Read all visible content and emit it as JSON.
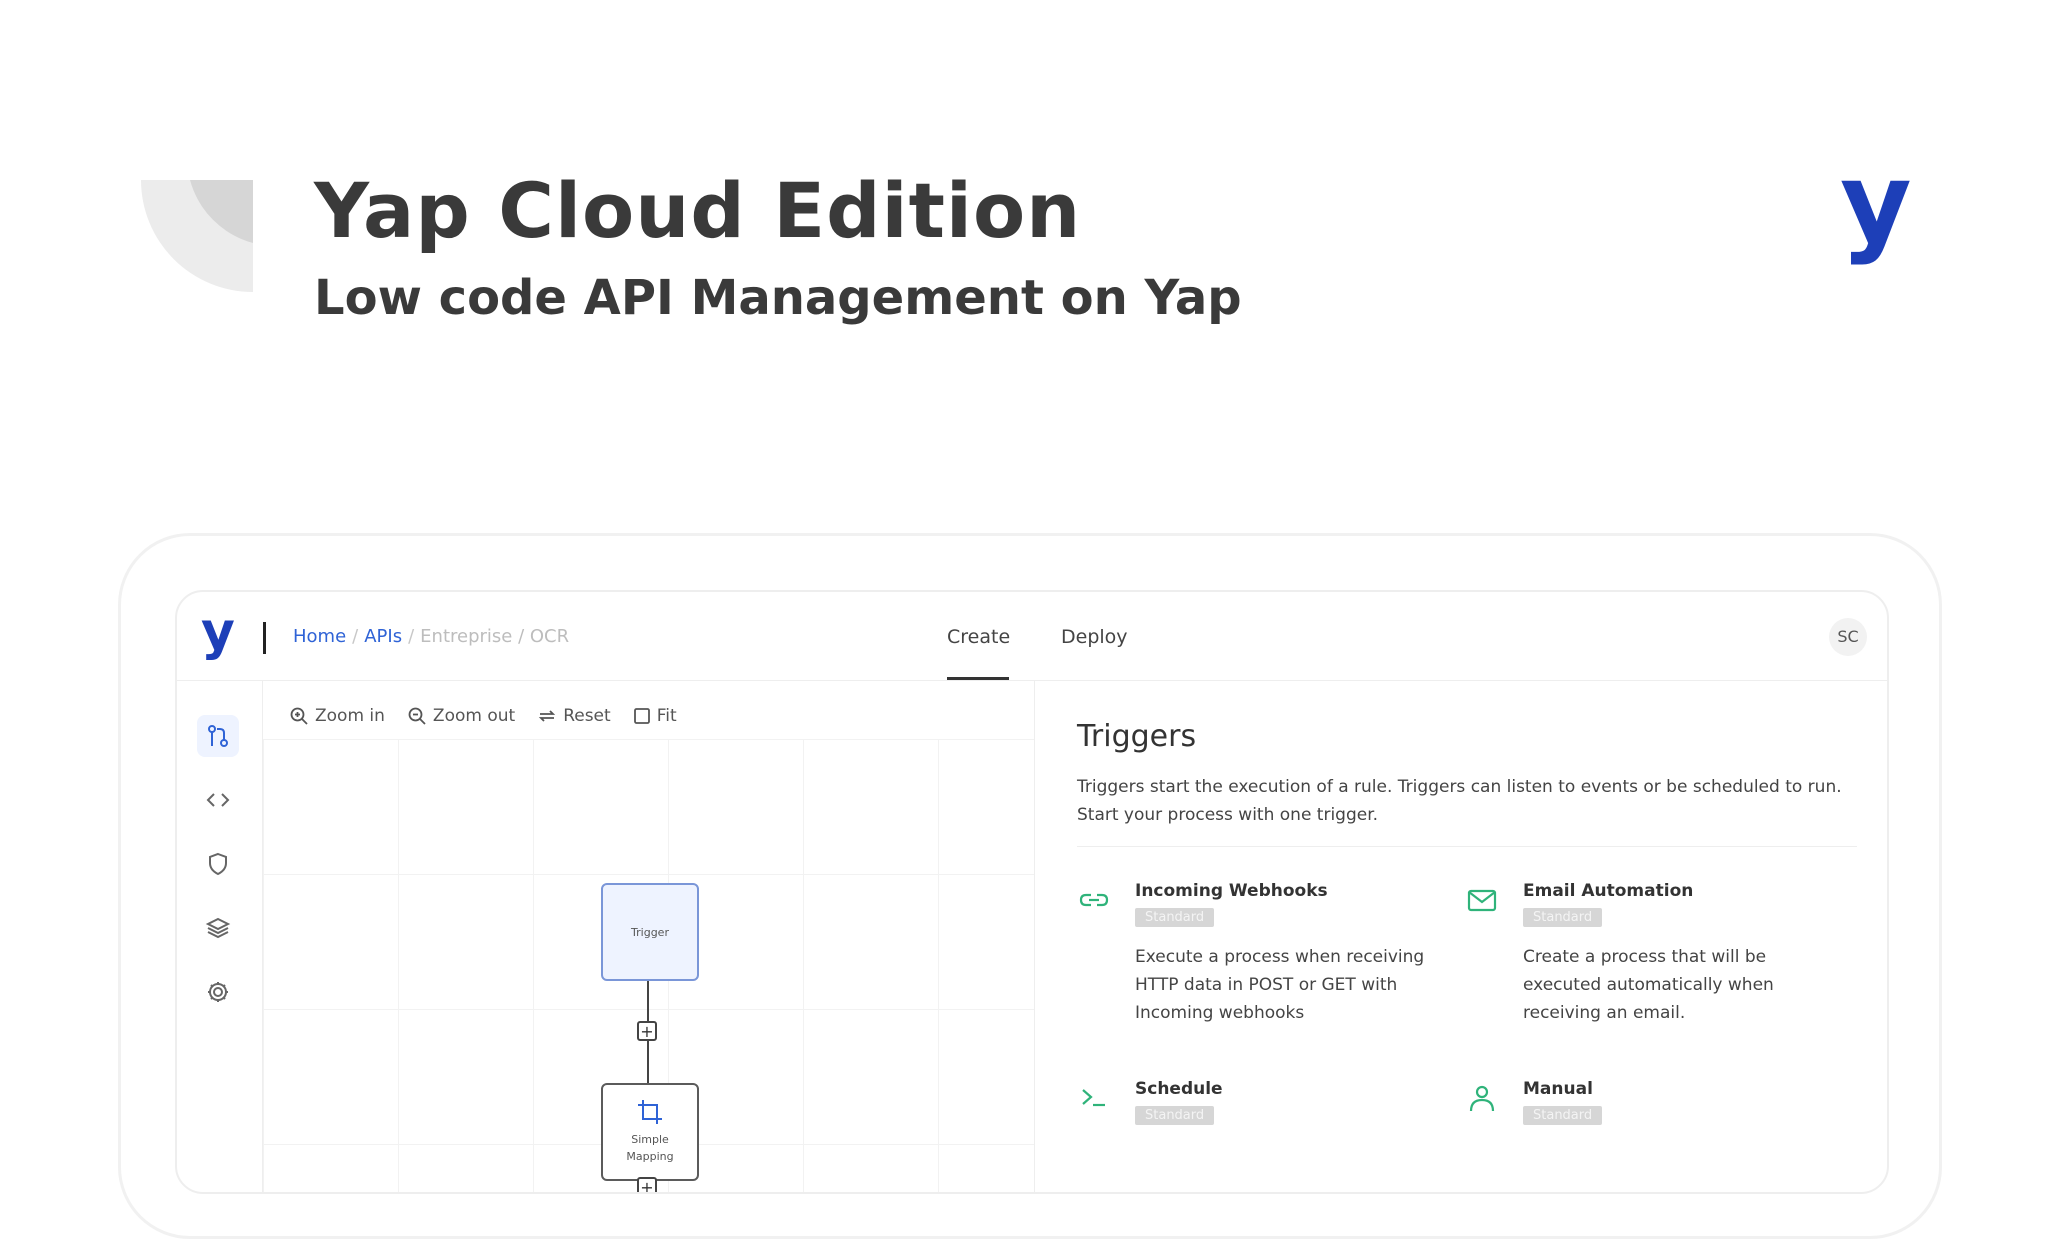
{
  "hero": {
    "title": "Yap Cloud Edition",
    "subtitle": "Low code API Management on Yap",
    "brand_mark": "y"
  },
  "app": {
    "logo": "y",
    "breadcrumb": {
      "items": [
        "Home",
        "APIs"
      ],
      "separator": "/",
      "current": "Entreprise / OCR"
    },
    "tabs": [
      {
        "label": "Create",
        "active": true
      },
      {
        "label": "Deploy",
        "active": false
      }
    ],
    "avatar_initials": "SC",
    "rail_icons": [
      "flow-icon",
      "code-icon",
      "shield-icon",
      "layers-icon",
      "gear-icon"
    ],
    "toolbar": {
      "zoom_in": "Zoom in",
      "zoom_out": "Zoom out",
      "reset": "Reset",
      "fit": "Fit"
    },
    "canvas": {
      "nodes": [
        {
          "label": "Trigger",
          "icon": ""
        },
        {
          "label_line1": "Simple",
          "label_line2": "Mapping",
          "icon": "crop-icon"
        }
      ]
    },
    "triggers_panel": {
      "title": "Triggers",
      "description": "Triggers start the execution of a rule. Triggers can listen to events or be scheduled to run. Start your process with one trigger.",
      "cards": [
        {
          "title": "Incoming Webhooks",
          "badge": "Standard",
          "description": "Execute a process when receiving HTTP data in POST or GET with Incoming webhooks",
          "icon": "link-icon"
        },
        {
          "title": "Email Automation",
          "badge": "Standard",
          "description": "Create a process that will be executed automatically when receiving an email.",
          "icon": "mail-icon"
        },
        {
          "title": "Schedule",
          "badge": "Standard",
          "description": "",
          "icon": "terminal-icon"
        },
        {
          "title": "Manual",
          "badge": "Standard",
          "description": "",
          "icon": "user-icon"
        }
      ]
    }
  },
  "colors": {
    "brand": "#1d3fb8",
    "link": "#2f63d6",
    "accent_green": "#2fb37a",
    "text": "#3a3a3a"
  }
}
